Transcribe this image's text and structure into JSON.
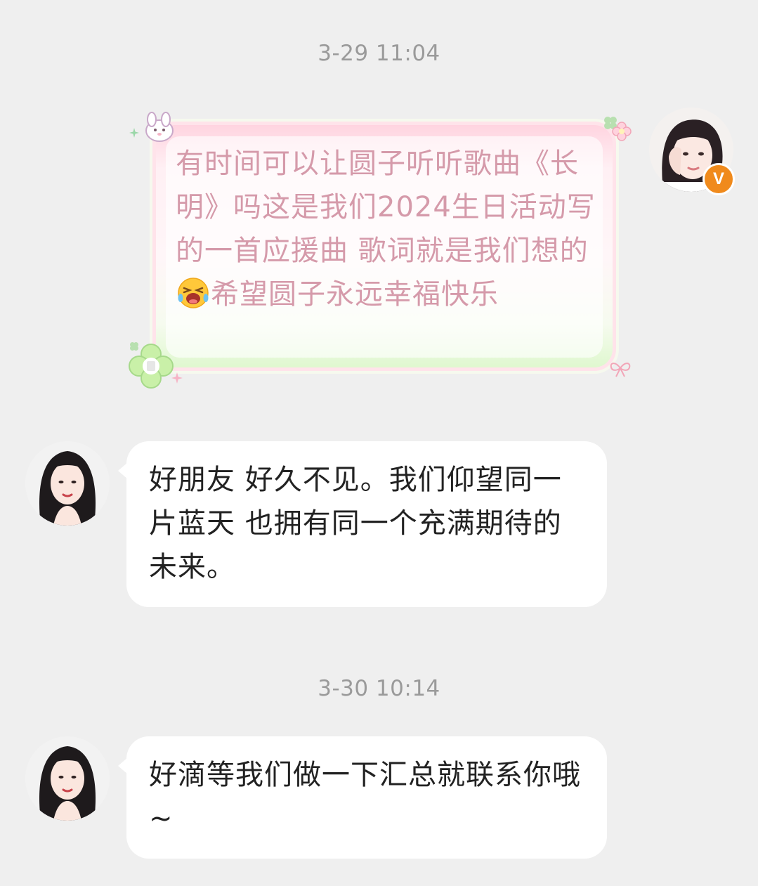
{
  "messages": [
    {
      "type": "timestamp",
      "text": "3-29 11:04"
    },
    {
      "type": "sent",
      "text_before_emoji": "有时间可以让圆子听听歌曲《长明》吗这是我们2024生日活动写的一首应援曲 歌词就是我们想的",
      "emoji": "crying-laughing-face",
      "text_after_emoji": "希望圆子永远幸福快乐",
      "avatar": "user-avatar",
      "badge": "V",
      "accent_color": "#d59aaa"
    },
    {
      "type": "received",
      "text": "好朋友 好久不见。我们仰望同一片蓝天 也拥有同一个充满期待的未来。",
      "avatar": "contact-avatar"
    },
    {
      "type": "timestamp",
      "text": "3-30 10:14"
    },
    {
      "type": "received",
      "text": "好滴等我们做一下汇总就联系你哦~",
      "avatar": "contact-avatar"
    }
  ],
  "colors": {
    "background": "#efefef",
    "bubble_received": "#ffffff",
    "badge": "#f08a1c",
    "timestamp": "#9a9a9a"
  }
}
